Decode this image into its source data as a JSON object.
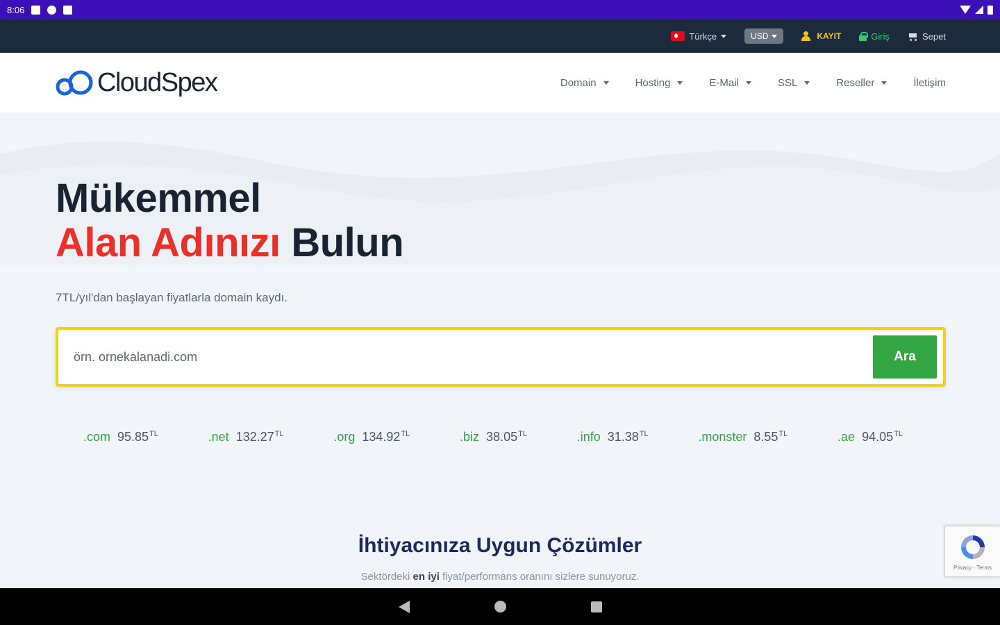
{
  "status_bar": {
    "time": "8:06"
  },
  "topbar": {
    "language": "Türkçe",
    "currency": "USD",
    "register": "KAYIT",
    "login": "Giriş",
    "cart": "Sepet"
  },
  "header": {
    "logo_text": "CloudSpex",
    "nav": [
      {
        "label": "Domain",
        "dropdown": true
      },
      {
        "label": "Hosting",
        "dropdown": true
      },
      {
        "label": "E-Mail",
        "dropdown": true
      },
      {
        "label": "SSL",
        "dropdown": true
      },
      {
        "label": "Reseller",
        "dropdown": true
      },
      {
        "label": "İletişim",
        "dropdown": false
      }
    ]
  },
  "hero": {
    "headline_line1": "Mükemmel",
    "headline_accent": "Alan Adınızı",
    "headline_rest": "Bulun",
    "subline": "7TL/yıl'dan başlayan fiyatlarla domain kaydı.",
    "search_placeholder": "örn. ornekalanadi.com",
    "search_button": "Ara",
    "tlds": [
      {
        "ext": ".com",
        "price": "95.85",
        "cur": "TL"
      },
      {
        "ext": ".net",
        "price": "132.27",
        "cur": "TL"
      },
      {
        "ext": ".org",
        "price": "134.92",
        "cur": "TL"
      },
      {
        "ext": ".biz",
        "price": "38.05",
        "cur": "TL"
      },
      {
        "ext": ".info",
        "price": "31.38",
        "cur": "TL"
      },
      {
        "ext": ".monster",
        "price": "8.55",
        "cur": "TL"
      },
      {
        "ext": ".ae",
        "price": "94.05",
        "cur": "TL"
      }
    ]
  },
  "solutions": {
    "title": "İhtiyacınıza Uygun Çözümler",
    "sub_before": "Sektördeki",
    "sub_bold": "en iyi",
    "sub_after": "fiyat/performans oranını sizlere sunuyoruz."
  },
  "recaptcha": {
    "text": "Privacy - Terms"
  },
  "colors": {
    "status_bar": "#3d0fb8",
    "topbar": "#1c2a3d",
    "accent_red": "#e8312a",
    "green": "#33a543",
    "search_border": "#f5cf1d",
    "title_navy": "#1a2a5c"
  }
}
